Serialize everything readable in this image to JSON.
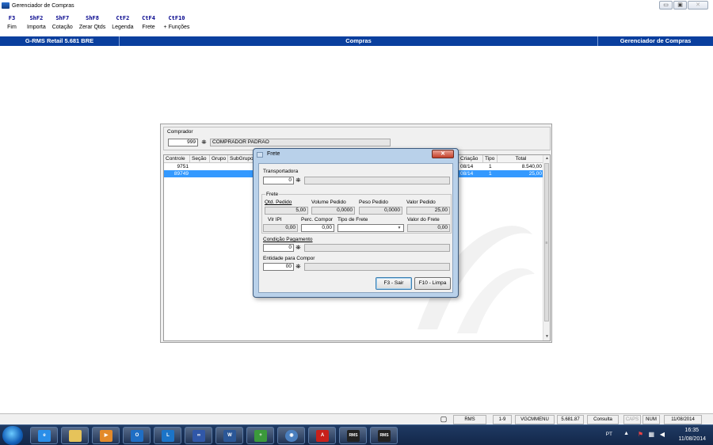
{
  "window": {
    "title": "Gerenciador de Compras"
  },
  "toolbar": [
    {
      "key": "F3",
      "label": "Fim"
    },
    {
      "key": "ShF2",
      "label": "Importa"
    },
    {
      "key": "ShF7",
      "label": "Cotação"
    },
    {
      "key": "ShF8",
      "label": "Zerar Qtds"
    },
    {
      "key": "CtF2",
      "label": "Legenda"
    },
    {
      "key": "CtF4",
      "label": "Frete"
    },
    {
      "key": "CtF10",
      "label": "+ Funções"
    }
  ],
  "header": {
    "left": "G-RMS Retail 5.681 BRE",
    "center": "Compras",
    "right": "Gerenciador de Compras"
  },
  "comprador": {
    "label": "Comprador",
    "code": "999",
    "name": "COMPRADOR PADRÃO"
  },
  "grid": {
    "columns": [
      "Controle",
      "Seção",
      "Grupo",
      "SubGrupo",
      "Criação",
      "Tipo",
      "Total"
    ],
    "rows": [
      {
        "controle": "9751",
        "criacao": "08/14",
        "tipo": "1",
        "total": "8.540,00"
      },
      {
        "controle": "89749",
        "criacao": "08/14",
        "tipo": "1",
        "total": "25,00"
      }
    ]
  },
  "dialog": {
    "title": "Frete",
    "transportadora": {
      "label": "Transportadora",
      "code": "0"
    },
    "frete": {
      "legend": "Frete",
      "qtd_pedido_label": "Qtd. Pedido",
      "qtd_pedido": "5,00",
      "volume_label": "Volume Pedido",
      "volume": "0,0000",
      "peso_label": "Peso Pedido",
      "peso": "0,0000",
      "valor_label": "Valor Pedido",
      "valor": "25,00",
      "vlr_ipi_label": "Vlr IPI",
      "vlr_ipi": "0,00",
      "perc_label": "Perc. Compor",
      "perc": "0,00",
      "tipo_label": "Tipo de Frete",
      "tipo": "",
      "valor_frete_label": "Valor do Frete",
      "valor_frete": "0,00"
    },
    "condicao": {
      "label": "Condição Pagamento",
      "code": "0"
    },
    "entidade": {
      "label": "Entidade para Compor",
      "code": "00"
    },
    "buttons": {
      "sair": "F3 - Sair",
      "limpa": "F10 - Limpa"
    }
  },
  "status": {
    "cells": [
      "RMS",
      "1-9",
      "VGCMMENU",
      "5.681.87",
      "Consulta",
      "CAPS",
      "NUM",
      "11/08/2014"
    ]
  },
  "taskbar": {
    "apps": [
      "ie",
      "explorer",
      "media",
      "outlook",
      "lync",
      "infinity",
      "word",
      "network",
      "ie-alt",
      "acrobat",
      "rms",
      "rms"
    ],
    "tray": {
      "lang": "PT",
      "time": "16:35",
      "date": "11/08/2014"
    }
  },
  "colors": {
    "header_blue": "#0a3f9e",
    "selection": "#3399ff",
    "dialog_frame": "#b9d1ea"
  }
}
